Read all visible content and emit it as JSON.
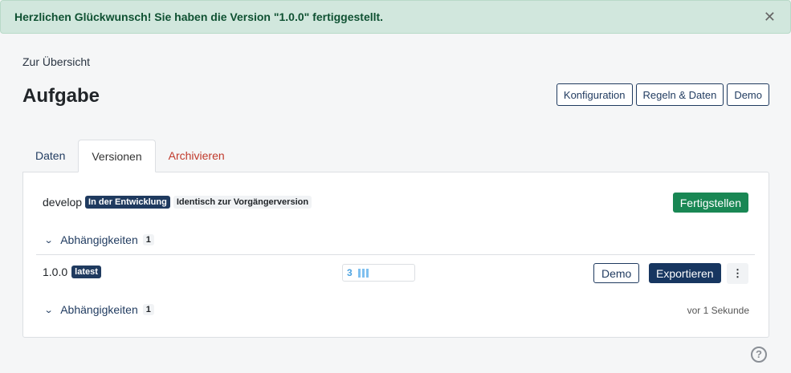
{
  "alert": {
    "message": "Herzlichen Glückwunsch! Sie haben die Version \"1.0.0\" fertiggestellt.",
    "close_glyph": "✕"
  },
  "header": {
    "back_link": "Zur Übersicht",
    "title": "Aufgabe",
    "buttons": {
      "config": "Konfiguration",
      "rules": "Regeln & Daten",
      "demo": "Demo"
    }
  },
  "tabs": {
    "data": "Daten",
    "versions": "Versionen",
    "archive": "Archivieren"
  },
  "develop": {
    "name": "develop",
    "status_badge": "In der Entwicklung",
    "identical_badge": "Identisch zur Vorgängerversion",
    "finish_button": "Fertigstellen",
    "dependencies_label": "Abhängigkeiten",
    "dependencies_count": "1"
  },
  "release": {
    "name": "1.0.0",
    "latest_badge": "latest",
    "progress_count": "3",
    "demo_button": "Demo",
    "export_button": "Exportieren",
    "more_glyph": "⋮",
    "dependencies_label": "Abhängigkeiten",
    "dependencies_count": "1",
    "timestamp": "vor 1 Sekunde"
  },
  "help_glyph": "?",
  "colors": {
    "primary": "#173660",
    "success": "#198754",
    "danger": "#c0392b",
    "alert_bg": "#d1e7dd"
  }
}
